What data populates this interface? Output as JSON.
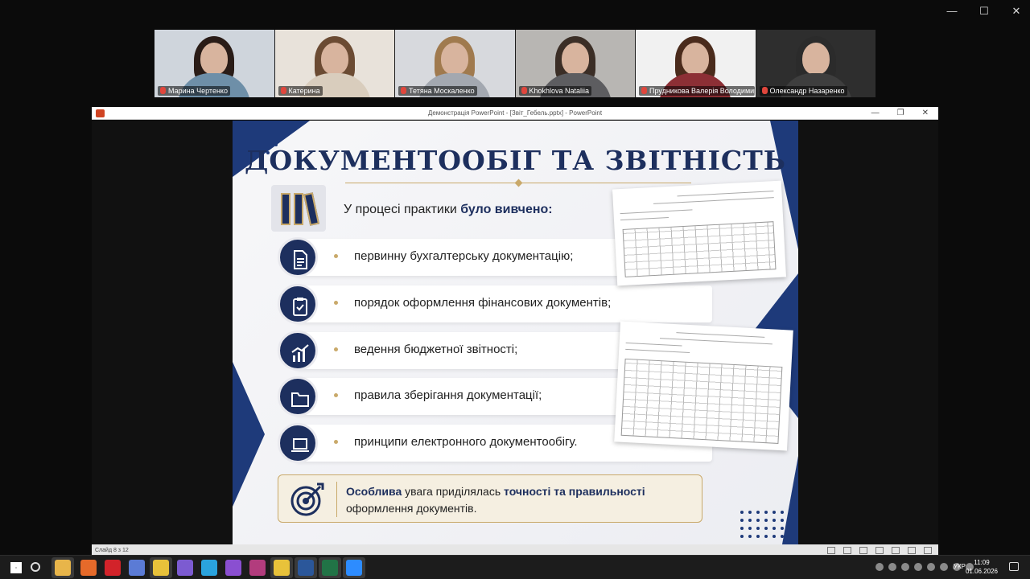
{
  "window": {
    "controls": [
      "—",
      "☐",
      "✕"
    ]
  },
  "participants": [
    {
      "name": "Марина Чертенко",
      "bg": "#cfd5dc",
      "hair": "#2a1c17",
      "shirt": "#6e8fa8"
    },
    {
      "name": "Катерина",
      "bg": "#e8e2da",
      "hair": "#6b4b33",
      "shirt": "#d9cdbd"
    },
    {
      "name": "Тетяна Москаленко",
      "bg": "#d7d9dd",
      "hair": "#a07a4e",
      "shirt": "#a3a8b0"
    },
    {
      "name": "Khokhlova Nataliia",
      "bg": "#b8b6b3",
      "hair": "#3b2e26",
      "shirt": "#5d5d60"
    },
    {
      "name": "Прудникова Валерія Володимир...",
      "bg": "#f1f1f1",
      "hair": "#4a2b1c",
      "shirt": "#8c2f35"
    },
    {
      "name": "Олександр Назаренко",
      "bg": "#2e2e2e",
      "hair": "#2b2b2b",
      "shirt": "#3e3e3e"
    }
  ],
  "ppt": {
    "title": "Демонстрація PowerPoint - [Звіт_Гебель.pptx] - PowerPoint",
    "status": "Слайд 8 з 12",
    "controls": [
      "—",
      "❐",
      "✕"
    ]
  },
  "slide": {
    "title": "ДОКУМЕНТООБІГ ТА ЗВІТНІСТЬ",
    "intro_prefix": "У процесі практики ",
    "intro_bold": "було вивчено:",
    "items": [
      {
        "icon": "document-icon",
        "text": "первинну бухгалтерську документацію;"
      },
      {
        "icon": "clipboard-check-icon",
        "text": "порядок оформлення фінансових документів;"
      },
      {
        "icon": "growth-chart-icon",
        "text": "ведення бюджетної звітності;"
      },
      {
        "icon": "folder-icon",
        "text": "правила зберігання документації;"
      },
      {
        "icon": "laptop-icon",
        "text": "принципи електронного документообігу."
      }
    ],
    "callout": {
      "bold1": "Особлива",
      "mid": " увага приділялась ",
      "bold2": "точності та правильності",
      "line2": "оформлення документів."
    },
    "colors": {
      "navy": "#1d2f5e",
      "gold": "#c9a96a"
    }
  },
  "taskbar": {
    "lang": "УКР",
    "time": "11:09",
    "date": "01.06.2026",
    "apps": [
      "start-icon",
      "search-icon",
      "file-explorer-icon",
      "firefox-icon",
      "opera-icon",
      "notepad-icon",
      "chrome-icon",
      "viber-icon",
      "telegram-icon",
      "visual-studio-icon",
      "winrar-icon",
      "chrome-profile-icon",
      "word-icon",
      "excel-icon",
      "zoom-icon"
    ]
  }
}
